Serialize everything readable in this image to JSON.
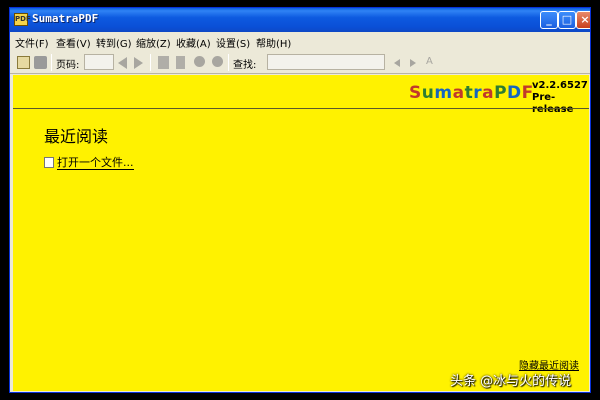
{
  "window": {
    "title": "SumatraPDF"
  },
  "menu": [
    "文件(F)",
    "查看(V)",
    "转到(G)",
    "缩放(Z)",
    "收藏(A)",
    "设置(S)",
    "帮助(H)"
  ],
  "toolbar": {
    "page_label": "页码:",
    "find_label": "查找:"
  },
  "content": {
    "logo_letters": [
      "S",
      "u",
      "m",
      "a",
      "t",
      "r",
      "a",
      "P",
      "D",
      "F"
    ],
    "logo_colors": [
      "#c0392b",
      "#2e7d32",
      "#1565c0",
      "#c0392b",
      "#2e7d32",
      "#1565c0",
      "#c0392b",
      "#2e7d32",
      "#1565c0",
      "#c0392b"
    ],
    "version": "v2.2.6527",
    "release": "Pre-release",
    "recent_title": "最近阅读",
    "open_file": "打开一个文件...",
    "hide_recent": "隐藏最近阅读"
  },
  "watermark": "头条 @冰与火的传说",
  "colors": {
    "content_bg": "#fff200",
    "titlebar": "#0a5fe0"
  }
}
